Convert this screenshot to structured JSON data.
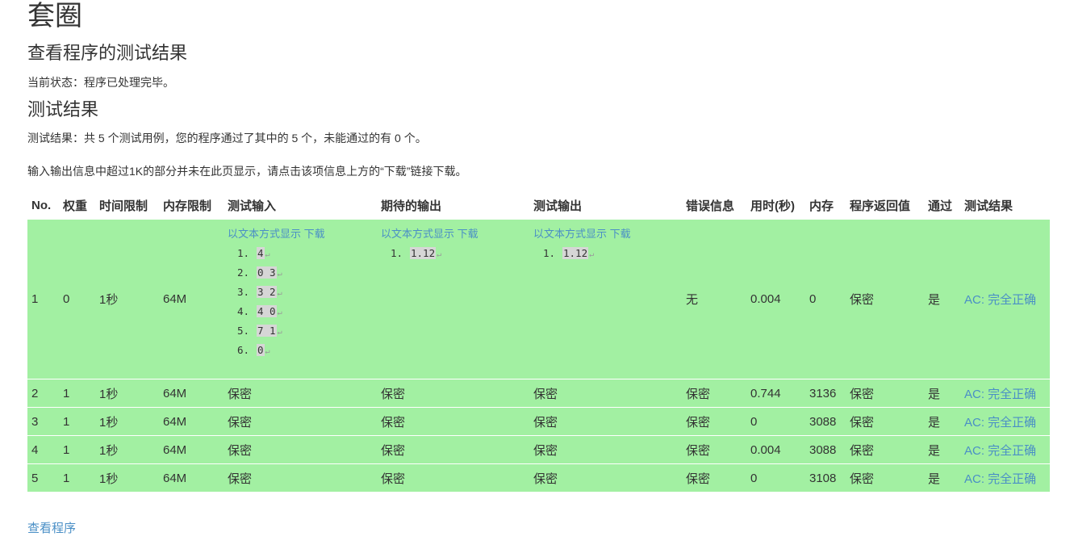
{
  "page": {
    "title": "套圈",
    "subtitle": "查看程序的测试结果",
    "status_text": "当前状态：程序已处理完毕。",
    "results_heading": "测试结果",
    "summary_text": "测试结果：共 5 个测试用例，您的程序通过了其中的 5 个，未能通过的有 0 个。",
    "notice_text": "输入输出信息中超过1K的部分并未在此页显示，请点击该项信息上方的“下载”链接下载。",
    "view_program_link": "查看程序"
  },
  "table": {
    "headers": [
      "No.",
      "权重",
      "时间限制",
      "内存限制",
      "测试输入",
      "期待的输出",
      "测试输出",
      "错误信息",
      "用时(秒)",
      "内存",
      "程序返回值",
      "通过",
      "测试结果"
    ],
    "show_text_link": "以文本方式显示",
    "download_link": "下载",
    "eol_mark": "↵",
    "row1": {
      "no": "1",
      "weight": "0",
      "time_limit": "1秒",
      "mem_limit": "64M",
      "input_lines": [
        {
          "n": "1.",
          "text": "4"
        },
        {
          "n": "2.",
          "text": "0 3"
        },
        {
          "n": "3.",
          "text": "3 2"
        },
        {
          "n": "4.",
          "text": "4 0"
        },
        {
          "n": "5.",
          "text": "7 1"
        },
        {
          "n": "6.",
          "text": "0"
        }
      ],
      "expected_lines": [
        {
          "n": "1.",
          "text": "1.12"
        }
      ],
      "output_lines": [
        {
          "n": "1.",
          "text": "1.12"
        }
      ],
      "error": "无",
      "time": "0.004",
      "memory": "0",
      "return_value": "保密",
      "passed": "是",
      "result": "AC: 完全正确"
    },
    "rows": [
      {
        "no": "2",
        "weight": "1",
        "time_limit": "1秒",
        "mem_limit": "64M",
        "input": "保密",
        "expected": "保密",
        "output": "保密",
        "error": "保密",
        "time": "0.744",
        "memory": "3136",
        "return_value": "保密",
        "passed": "是",
        "result": "AC: 完全正确"
      },
      {
        "no": "3",
        "weight": "1",
        "time_limit": "1秒",
        "mem_limit": "64M",
        "input": "保密",
        "expected": "保密",
        "output": "保密",
        "error": "保密",
        "time": "0",
        "memory": "3088",
        "return_value": "保密",
        "passed": "是",
        "result": "AC: 完全正确"
      },
      {
        "no": "4",
        "weight": "1",
        "time_limit": "1秒",
        "mem_limit": "64M",
        "input": "保密",
        "expected": "保密",
        "output": "保密",
        "error": "保密",
        "time": "0.004",
        "memory": "3088",
        "return_value": "保密",
        "passed": "是",
        "result": "AC: 完全正确"
      },
      {
        "no": "5",
        "weight": "1",
        "time_limit": "1秒",
        "mem_limit": "64M",
        "input": "保密",
        "expected": "保密",
        "output": "保密",
        "error": "保密",
        "time": "0",
        "memory": "3108",
        "return_value": "保密",
        "passed": "是",
        "result": "AC: 完全正确"
      }
    ]
  },
  "colors": {
    "pass_row_bg": "#a2f0a2",
    "link": "#4a8fc6",
    "text": "#333333"
  }
}
